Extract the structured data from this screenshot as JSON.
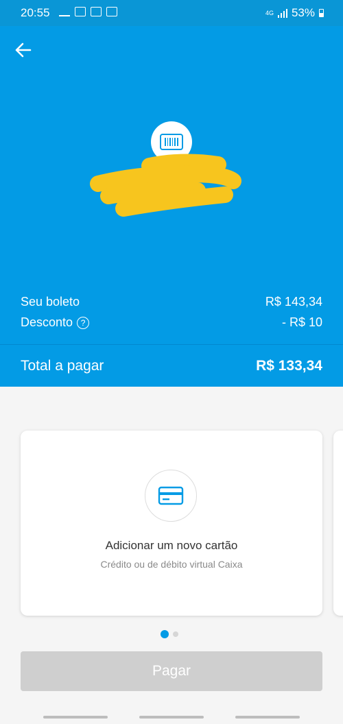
{
  "status_bar": {
    "time": "20:55",
    "network": "4G",
    "battery": "53%"
  },
  "header": {
    "back_icon": "arrow-left-icon",
    "badge_icon": "barcode-icon",
    "boleto_label": "Seu boleto",
    "boleto_value": "R$ 143,34",
    "desconto_label": "Desconto",
    "desconto_help": "?",
    "desconto_value": "- R$ 10",
    "total_label": "Total a pagar",
    "total_value": "R$ 133,34"
  },
  "card": {
    "icon": "credit-card-icon",
    "title": "Adicionar um novo cartão",
    "subtitle": "Crédito ou de débito virtual Caixa"
  },
  "pagination": {
    "active_index": 0,
    "count": 2
  },
  "pay_button": {
    "label": "Pagar"
  },
  "colors": {
    "primary": "#039be5",
    "status_bar": "#0a96d6",
    "disabled_button": "#cfcfcf",
    "redaction": "#f7c51e"
  }
}
